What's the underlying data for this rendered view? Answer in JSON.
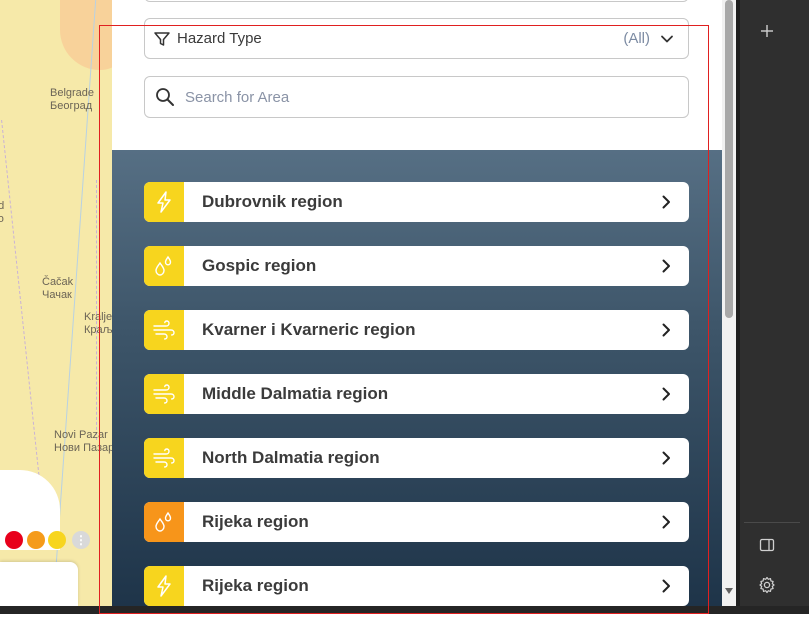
{
  "map": {
    "cities": [
      {
        "name": "belgrade",
        "latin": "Belgrade",
        "cyrillic": "Београд"
      },
      {
        "name": "cacak",
        "latin": "Čačak",
        "cyrillic": "Чачак"
      },
      {
        "name": "kraljevo",
        "latin": "Kralje",
        "cyrillic": "Краљ"
      },
      {
        "name": "novi-pazar",
        "latin": "Novi Pazar",
        "cyrillic": "Нови Пазар"
      },
      {
        "name": "partial",
        "latin": "ad",
        "cyrillic": "во"
      }
    ],
    "legend_colors": [
      "#e8001c",
      "#f59b1a",
      "#f7d51e"
    ],
    "legend_more": "⋮"
  },
  "filter": {
    "label": "Hazard Type",
    "value": "(All)",
    "icon": "filter-icon"
  },
  "search": {
    "placeholder": "Search for Area",
    "icon": "search-icon"
  },
  "regions": [
    {
      "label": "Dubrovnik region",
      "hazard": "thunderstorm",
      "color": "#f7d51e"
    },
    {
      "label": "Gospic region",
      "hazard": "rain",
      "color": "#f7d51e"
    },
    {
      "label": "Kvarner i Kvarneric region",
      "hazard": "wind",
      "color": "#f7d51e"
    },
    {
      "label": "Middle Dalmatia region",
      "hazard": "wind",
      "color": "#f7d51e"
    },
    {
      "label": "North Dalmatia region",
      "hazard": "wind",
      "color": "#f7d51e"
    },
    {
      "label": "Rijeka region",
      "hazard": "rain",
      "color": "#f7951a"
    },
    {
      "label": "Rijeka region",
      "hazard": "thunderstorm",
      "color": "#f7d51e"
    }
  ],
  "sidebar": {
    "icons": [
      "plus-icon",
      "panel-icon",
      "gear-icon"
    ]
  }
}
